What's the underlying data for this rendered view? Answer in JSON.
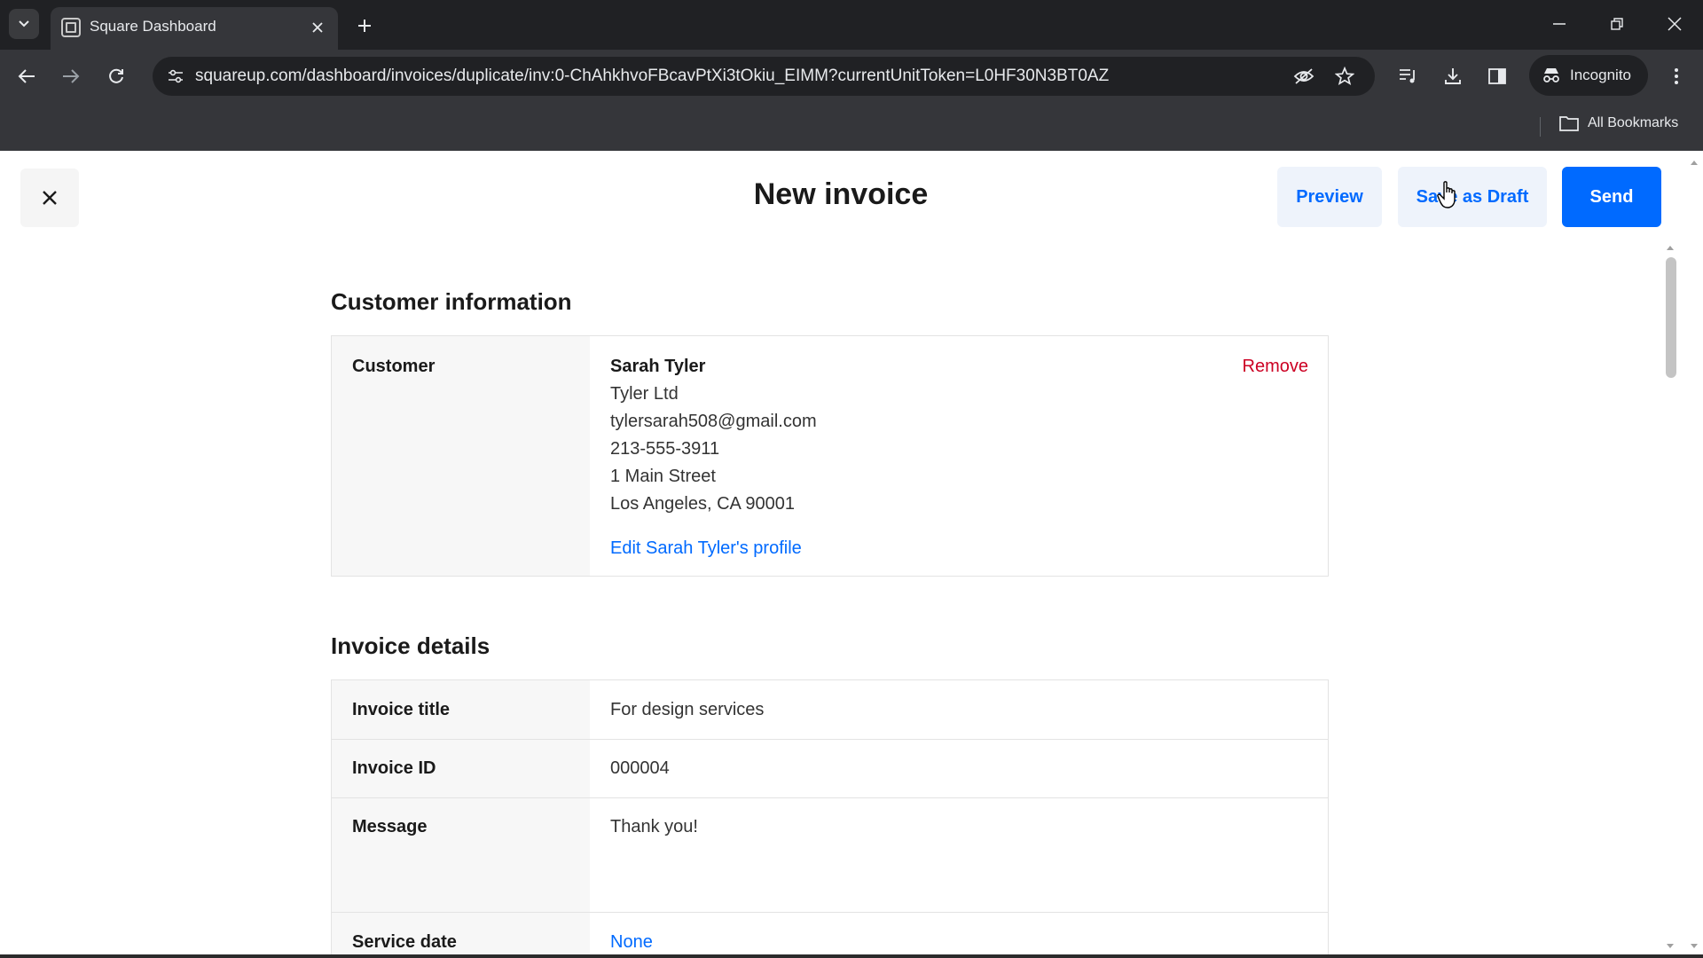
{
  "browser": {
    "tab_title": "Square Dashboard",
    "url": "squareup.com/dashboard/invoices/duplicate/inv:0-ChAhkhvoFBcavPtXi3tOkiu_EIMM?currentUnitToken=L0HF30N3BT0AZ",
    "incognito_label": "Incognito",
    "bookmarks_label": "All Bookmarks"
  },
  "header": {
    "title": "New invoice",
    "preview_label": "Preview",
    "save_draft_label": "Save as Draft",
    "send_label": "Send"
  },
  "customer_section": {
    "title": "Customer information",
    "label": "Customer",
    "name": "Sarah Tyler",
    "company": "Tyler Ltd",
    "email": "tylersarah508@gmail.com",
    "phone": "213-555-3911",
    "street": "1 Main Street",
    "city": "Los Angeles, CA 90001",
    "edit_link": "Edit Sarah Tyler's profile",
    "remove_label": "Remove"
  },
  "invoice_section": {
    "title": "Invoice details",
    "rows": [
      {
        "label": "Invoice title",
        "value": "For design services"
      },
      {
        "label": "Invoice ID",
        "value": "000004"
      },
      {
        "label": "Message",
        "value": "Thank you!"
      },
      {
        "label": "Service date",
        "value": "None"
      }
    ]
  },
  "colors": {
    "accent": "#006aff",
    "remove": "#cc0023"
  }
}
